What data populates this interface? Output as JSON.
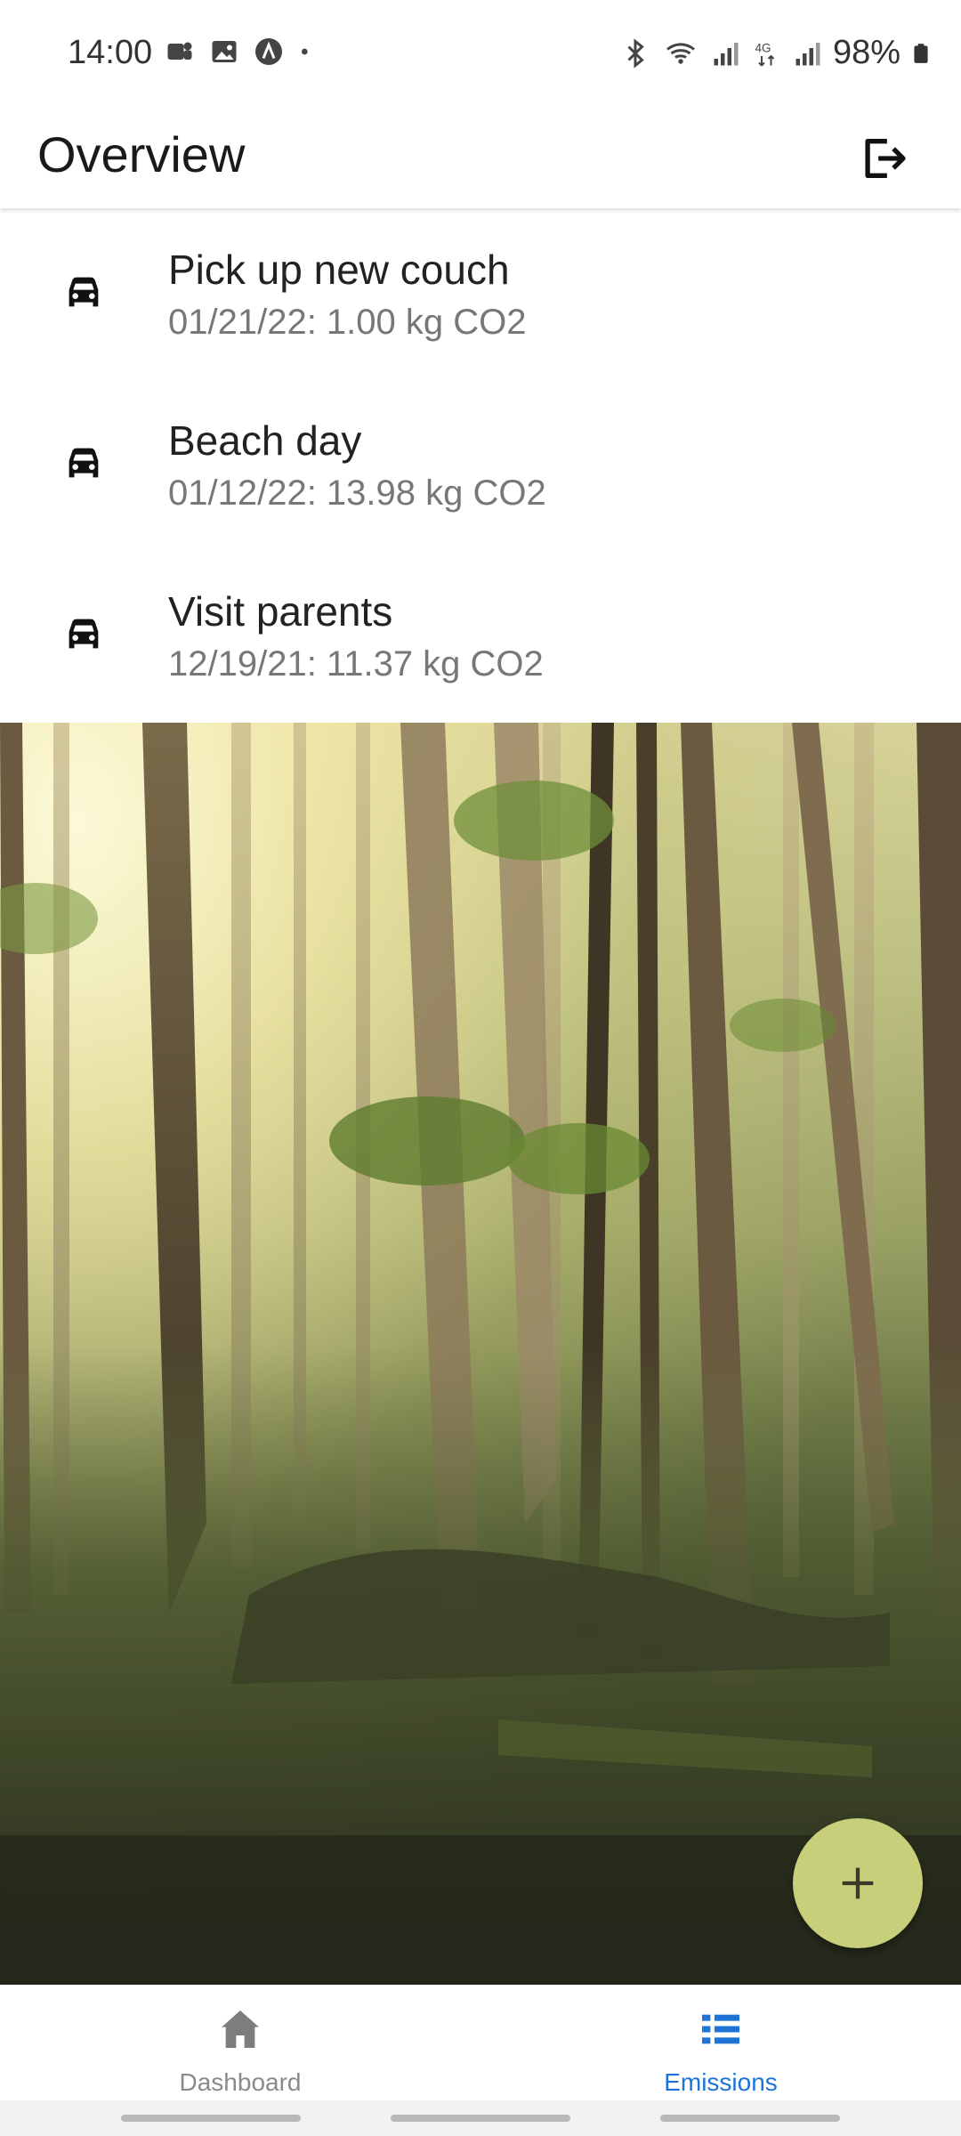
{
  "status_bar": {
    "time": "14:00",
    "battery_pct": "98%",
    "left_icons": [
      "teams-icon",
      "gallery-icon",
      "app-icon",
      "dot-icon"
    ],
    "right_icons": [
      "bluetooth-icon",
      "wifi-icon",
      "signal-icon",
      "4g-icon",
      "signal-icon",
      "battery-icon"
    ]
  },
  "app_bar": {
    "title": "Overview",
    "logout_icon": "logout-icon"
  },
  "emissions": [
    {
      "icon": "car-icon",
      "title": "Pick up new couch",
      "subtitle": "01/21/22: 1.00 kg CO2"
    },
    {
      "icon": "car-icon",
      "title": "Beach day",
      "subtitle": "01/12/22: 13.98 kg CO2"
    },
    {
      "icon": "car-icon",
      "title": "Visit parents",
      "subtitle": "12/19/21: 11.37 kg CO2"
    }
  ],
  "fab": {
    "icon": "plus-icon"
  },
  "bottom_nav": {
    "items": [
      {
        "label": "Dashboard",
        "icon": "home-icon",
        "active": false
      },
      {
        "label": "Emissions",
        "icon": "list-icon",
        "active": true
      }
    ]
  },
  "colors": {
    "accent": "#1e73d6",
    "fab": "#c8cf7b",
    "inactive": "#8a8a8a"
  }
}
